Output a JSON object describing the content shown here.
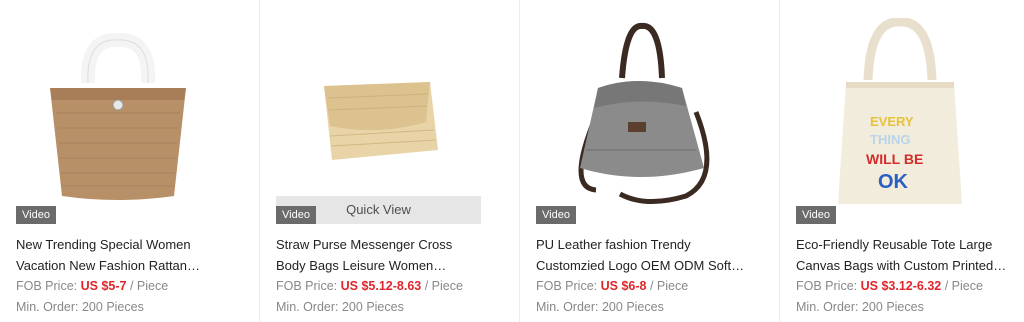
{
  "products": [
    {
      "video_label": "Video",
      "title_line1": "New Trending Special Women",
      "title_line2": "Vacation New Fashion Rattan…",
      "price_label": "FOB Price:",
      "price_value": "US $5-7",
      "price_unit": "/ Piece",
      "moq": "Min. Order: 200 Pieces",
      "image_icon": "rattan-tote-bag-image"
    },
    {
      "video_label": "Video",
      "quick_view": "Quick View",
      "title_line1": "Straw Purse Messenger Cross",
      "title_line2": "Body Bags Leisure Women…",
      "price_label": "FOB Price:",
      "price_value": "US $5.12-8.63",
      "price_unit": "/ Piece",
      "moq": "Min. Order: 200 Pieces",
      "image_icon": "straw-clutch-image"
    },
    {
      "video_label": "Video",
      "title_line1": "PU Leather fashion Trendy",
      "title_line2": "Customzied Logo OEM ODM Soft…",
      "price_label": "FOB Price:",
      "price_value": "US $6-8",
      "price_unit": "/ Piece",
      "moq": "Min. Order: 200 Pieces",
      "image_icon": "grey-shoulder-bag-image"
    },
    {
      "video_label": "Video",
      "title_line1": "Eco-Friendly Reusable Tote Large",
      "title_line2": "Canvas Bags with Custom Printed…",
      "price_label": "FOB Price:",
      "price_value": "US $3.12-6.32",
      "price_unit": "/ Piece",
      "moq": "Min. Order: 200 Pieces",
      "image_icon": "canvas-tote-image",
      "print_text": [
        "EVERY",
        "THING",
        "WILL BE",
        "OK"
      ]
    }
  ]
}
